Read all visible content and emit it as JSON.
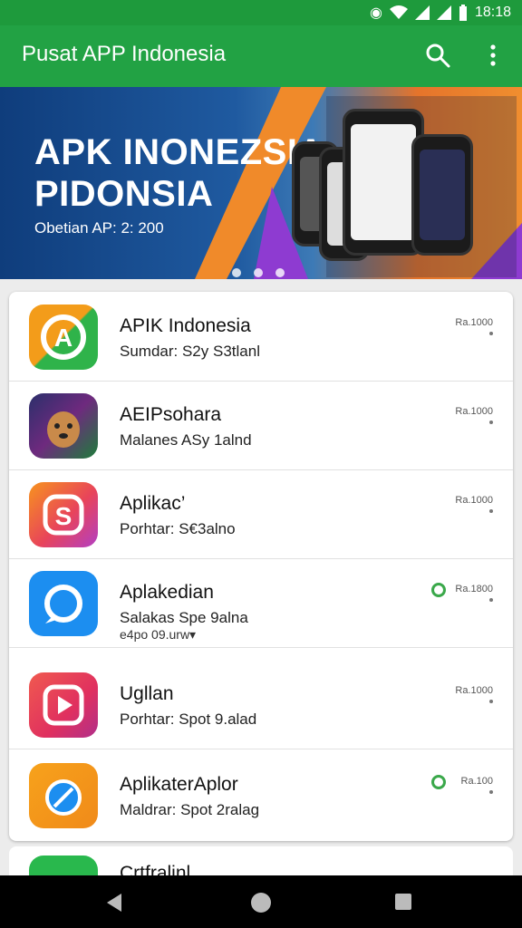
{
  "status_bar": {
    "time": "18:18",
    "icons": [
      "notification-icon",
      "wifi-icon",
      "signal-icon",
      "signal-icon",
      "battery-icon"
    ]
  },
  "appbar": {
    "title": "Pusat APP Indonesia",
    "search_icon": "search-icon",
    "more_icon": "more-vert-icon"
  },
  "banner": {
    "headline_1": "APK INONEZSIA",
    "headline_2": "PIDONSIA",
    "subtext": "Obetian AP: 2: 200",
    "indicator_count": 3,
    "active_indicator": 0
  },
  "apps": [
    {
      "name": "APIK Indonesia",
      "meta": "Sumdar: S2y S3tlanl",
      "size": "Ra.1000",
      "extra": "",
      "icon": "app-icon-green-orange"
    },
    {
      "name": "AEIPsohara",
      "meta": "Malanes ASy 1alnd",
      "size": "Ra.1000",
      "extra": "",
      "icon": "app-icon-dog"
    },
    {
      "name": "Aplikac’",
      "meta": "Porhtar: S€3alno",
      "size": "Ra.1000",
      "extra": "",
      "icon": "app-icon-s"
    },
    {
      "name": "Aplakedian",
      "meta": "Salakas Spe 9alna",
      "size": "Ra.1800",
      "extra": "e4po 09.urw▾",
      "icon": "app-icon-camera"
    },
    {
      "name": "Ugllan",
      "meta": "Porhtar: Spot 9.alad",
      "size": "Ra.1000",
      "extra": "",
      "icon": "app-icon-play"
    },
    {
      "name": "AplikaterAplor",
      "meta": "Maldrar: Spot 2ralag",
      "size": "Ra.100",
      "extra": "",
      "icon": "app-icon-compass"
    }
  ],
  "partial_app": {
    "name": "Crtfralinl"
  },
  "nav_bar": {
    "back_icon": "back-icon",
    "home_icon": "home-icon",
    "recents_icon": "recents-icon"
  },
  "colors": {
    "primary": "#22a244",
    "status": "#1e9a3c",
    "accent_green": "#3aa84a"
  }
}
